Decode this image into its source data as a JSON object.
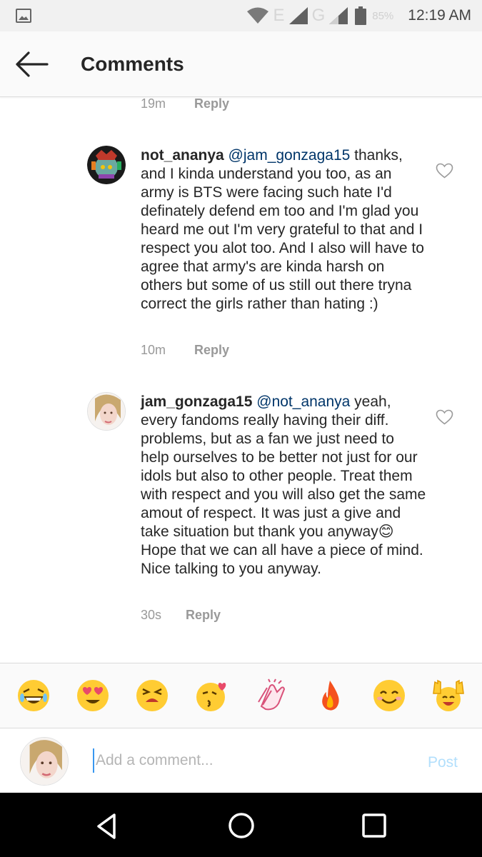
{
  "status_bar": {
    "network_e": "E",
    "network_g": "G",
    "battery": "85%",
    "time": "12:19 AM"
  },
  "header": {
    "title": "Comments"
  },
  "top_meta": {
    "time": "19m",
    "reply": "Reply"
  },
  "comments": [
    {
      "username": "not_ananya",
      "mention": "@jam_gonzaga15",
      "text": " thanks, and I kinda understand you too, as an army is BTS were facing such hate I'd definately defend em too and I'm glad you heard me out I'm very grateful to that and I respect you alot too. And I also will have to agree that army's are kinda harsh on others but some of us still out there tryna correct the girls rather than hating :)",
      "time": "10m",
      "reply": "Reply"
    },
    {
      "username": "jam_gonzaga15",
      "mention": "@not_ananya",
      "text_before_emoji": " yeah, every fandoms really having their diff. problems, but as a fan we just need to help ourselves to be better not just for our idols but also to other people. Treat them with respect and you will also get the same amout of respect. It was just a give and take situation but thank you anyway",
      "emoji": "😊",
      "text_after_emoji": " Hope that we can all have a piece of mind. Nice talking to you anyway.",
      "time": "30s",
      "reply": "Reply"
    }
  ],
  "emoji_bar": [
    "😂",
    "😍",
    "😫",
    "😘",
    "👏",
    "🔥",
    "😊",
    "🙌"
  ],
  "composer": {
    "placeholder": "Add a comment...",
    "post_label": "Post"
  },
  "colors": {
    "mention": "#003569",
    "meta": "#999999",
    "post_disabled": "#b2dffc"
  }
}
